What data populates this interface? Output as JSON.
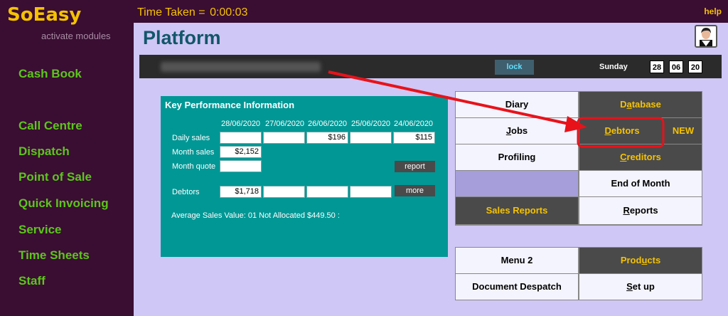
{
  "app": {
    "name": "SoEasy",
    "tagline": "activate modules",
    "help": "help"
  },
  "timer": {
    "label": "Time Taken =",
    "value": "0:00:03"
  },
  "sidebar": {
    "items": [
      "Cash Book",
      "Call Centre",
      "Dispatch",
      "Point of Sale",
      "Quick Invoicing",
      "Service",
      "Time Sheets",
      "Staff"
    ]
  },
  "page": {
    "title": "Platform"
  },
  "status": {
    "lock": "lock",
    "day": "Sunday",
    "date": [
      "28",
      "06",
      "20"
    ]
  },
  "kpi": {
    "title": "Key Performance Information",
    "dates": [
      "28/06/2020",
      "27/06/2020",
      "26/06/2020",
      "25/06/2020",
      "24/06/2020"
    ],
    "rows": {
      "daily_sales": {
        "label": "Daily sales",
        "values": [
          "",
          "",
          "$196",
          "",
          "$115"
        ]
      },
      "month_sales": {
        "label": "Month sales",
        "value": "$2,152"
      },
      "month_quote": {
        "label": "Month quote",
        "value": ""
      },
      "debtors": {
        "label": "Debtors",
        "values": [
          "$1,718",
          "",
          "",
          "",
          ""
        ]
      }
    },
    "report_button": "report",
    "more_button": "more",
    "average": "Average Sales Value: 01 Not Allocated $449.50 :"
  },
  "menu1": {
    "diary": "Diary",
    "database": "Database",
    "jobs": "Jobs",
    "debtors": "Debtors",
    "new_badge": "NEW",
    "profiling": "Profiling",
    "creditors": "Creditors",
    "end_of_month": "End of Month",
    "sales_reports": "Sales Reports",
    "reports": "Reports"
  },
  "menu2": {
    "menu2": "Menu 2",
    "products": "Products",
    "document_despatch": "Document Despatch",
    "setup": "Set up"
  },
  "colors": {
    "accent": "#f5c200",
    "nav": "#5cc61a",
    "teal": "#009795",
    "highlight": "#e8121a"
  }
}
